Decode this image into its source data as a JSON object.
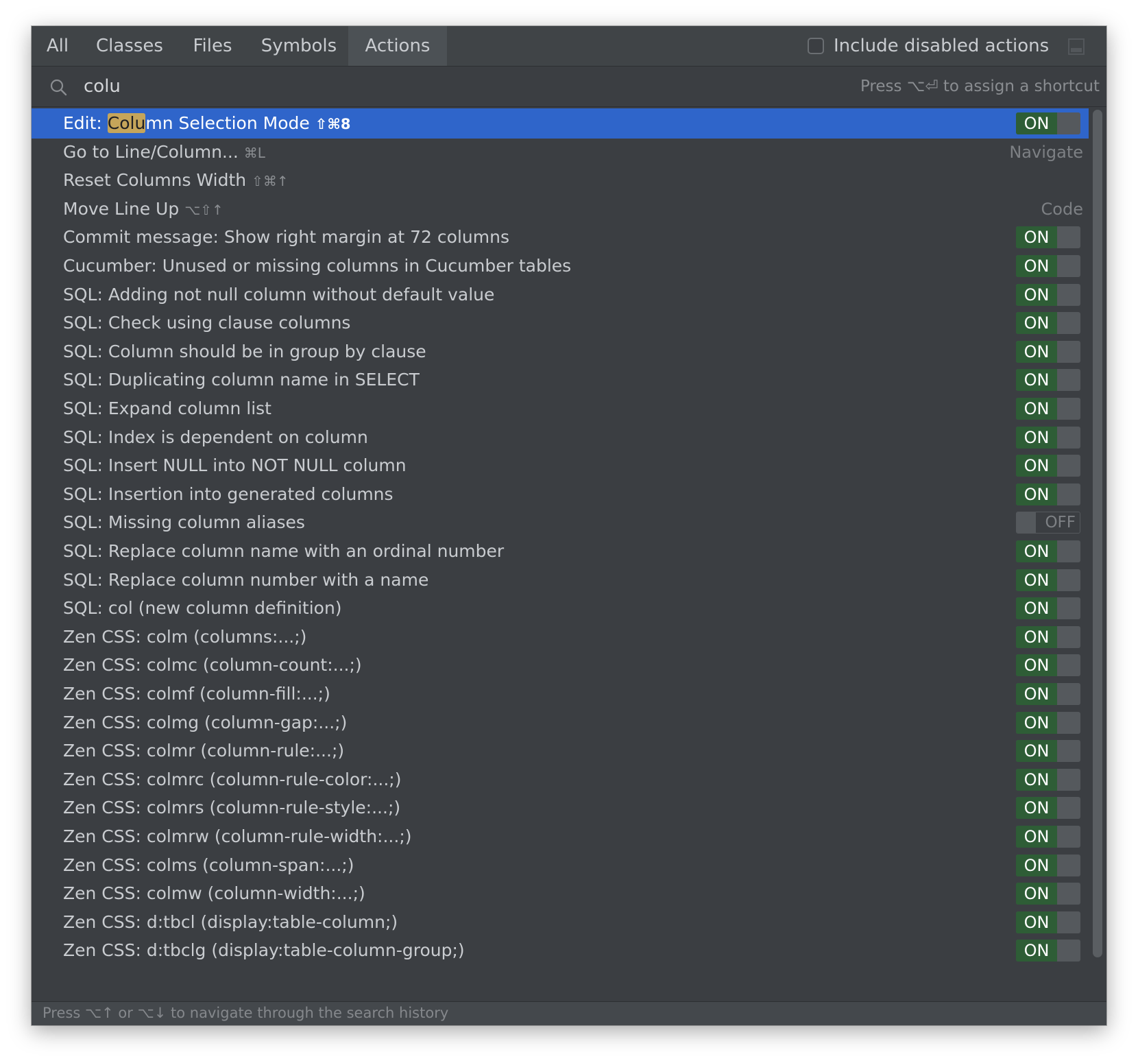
{
  "tabs": [
    "All",
    "Classes",
    "Files",
    "Symbols",
    "Actions"
  ],
  "include_disabled_label": "Include disabled actions",
  "search": {
    "value": "colu",
    "hint": "Press ⌥⏎ to assign a shortcut"
  },
  "selected": {
    "prefix": "Edit: ",
    "highlight": "Colu",
    "rest": "mn Selection Mode",
    "shortcut": "⇧⌘8",
    "toggle": "ON"
  },
  "nav_rows": [
    {
      "label": "Go to Line/Column...",
      "shortcut": "⌘L",
      "category": "Navigate"
    },
    {
      "label": "Reset Columns Width",
      "shortcut": "⇧⌘↑",
      "category": ""
    },
    {
      "label": "Move Line Up",
      "shortcut": "⌥⇧↑",
      "category": "Code"
    }
  ],
  "toggle_rows": [
    {
      "label": "Commit message: Show right margin at 72 columns",
      "state": "ON"
    },
    {
      "label": "Cucumber: Unused or missing columns in Cucumber tables",
      "state": "ON"
    },
    {
      "label": "SQL: Adding not null column without default value",
      "state": "ON"
    },
    {
      "label": "SQL: Check using clause columns",
      "state": "ON"
    },
    {
      "label": "SQL: Column should be in group by clause",
      "state": "ON"
    },
    {
      "label": "SQL: Duplicating column name in SELECT",
      "state": "ON"
    },
    {
      "label": "SQL: Expand column list",
      "state": "ON"
    },
    {
      "label": "SQL: Index is dependent on column",
      "state": "ON"
    },
    {
      "label": "SQL: Insert NULL into NOT NULL column",
      "state": "ON"
    },
    {
      "label": "SQL: Insertion into generated columns",
      "state": "ON"
    },
    {
      "label": "SQL: Missing column aliases",
      "state": "OFF"
    },
    {
      "label": "SQL: Replace column name with an ordinal number",
      "state": "ON"
    },
    {
      "label": "SQL: Replace column number with a name",
      "state": "ON"
    },
    {
      "label": "SQL: col (new column definition)",
      "state": "ON"
    },
    {
      "label": "Zen CSS: colm (columns:...;)",
      "state": "ON"
    },
    {
      "label": "Zen CSS: colmc (column-count:...;)",
      "state": "ON"
    },
    {
      "label": "Zen CSS: colmf (column-fill:...;)",
      "state": "ON"
    },
    {
      "label": "Zen CSS: colmg (column-gap:...;)",
      "state": "ON"
    },
    {
      "label": "Zen CSS: colmr (column-rule:...;)",
      "state": "ON"
    },
    {
      "label": "Zen CSS: colmrc (column-rule-color:...;)",
      "state": "ON"
    },
    {
      "label": "Zen CSS: colmrs (column-rule-style:...;)",
      "state": "ON"
    },
    {
      "label": "Zen CSS: colmrw (column-rule-width:...;)",
      "state": "ON"
    },
    {
      "label": "Zen CSS: colms (column-span:...;)",
      "state": "ON"
    },
    {
      "label": "Zen CSS: colmw (column-width:...;)",
      "state": "ON"
    },
    {
      "label": "Zen CSS: d:tbcl (display:table-column;)",
      "state": "ON"
    },
    {
      "label": "Zen CSS: d:tbclg (display:table-column-group;)",
      "state": "ON"
    }
  ],
  "footer": "Press ⌥↑ or ⌥↓ to navigate through the search history",
  "colors": {
    "background": "#3b3e42",
    "selection": "#2f65ca",
    "toggle_on": "#2e5d36",
    "highlight": "#c5a55a"
  }
}
